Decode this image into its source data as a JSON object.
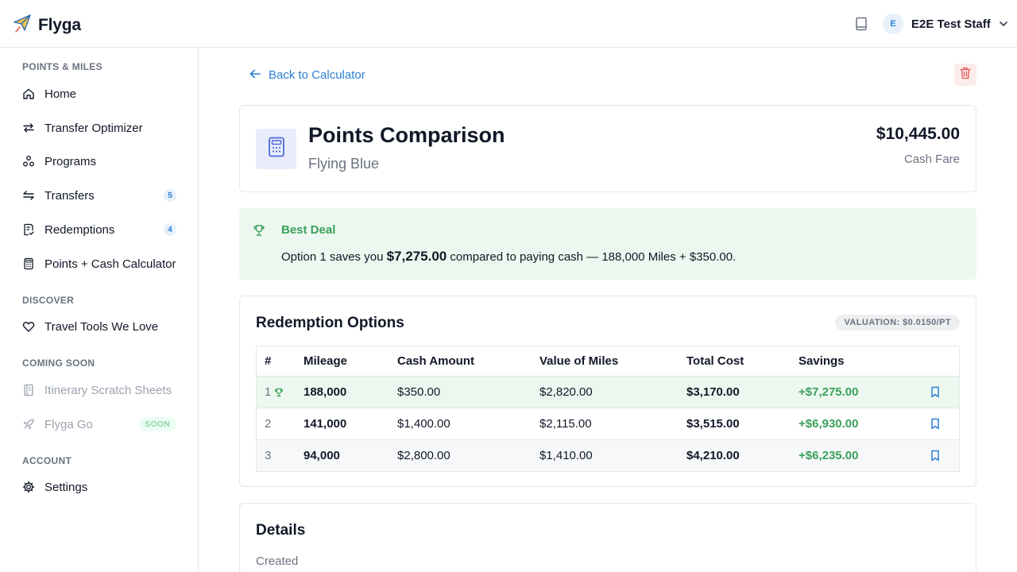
{
  "header": {
    "brand": "Flyga",
    "user_initial": "E",
    "user_name": "E2E Test Staff"
  },
  "sidebar": {
    "sections": [
      {
        "title": "POINTS & MILES"
      },
      {
        "title": "DISCOVER"
      },
      {
        "title": "COMING SOON"
      },
      {
        "title": "ACCOUNT"
      }
    ],
    "items": [
      {
        "label": "Home",
        "icon": "home-icon"
      },
      {
        "label": "Transfer Optimizer",
        "icon": "swap-icon"
      },
      {
        "label": "Programs",
        "icon": "programs-icon"
      },
      {
        "label": "Transfers",
        "icon": "transfers-icon",
        "badge": "5"
      },
      {
        "label": "Redemptions",
        "icon": "receipt-icon",
        "badge": "4"
      },
      {
        "label": "Points + Cash Calculator",
        "icon": "calculator-icon"
      },
      {
        "label": "Travel Tools We Love",
        "icon": "heart-icon"
      },
      {
        "label": "Itinerary Scratch Sheets",
        "icon": "notebook-icon"
      },
      {
        "label": "Flyga Go",
        "icon": "rocket-icon",
        "badge": "SOON"
      },
      {
        "label": "Settings",
        "icon": "gear-icon"
      }
    ]
  },
  "main": {
    "back_label": "Back to Calculator",
    "summary": {
      "title": "Points Comparison",
      "program": "Flying Blue",
      "cash_fare": "$10,445.00",
      "cash_fare_label": "Cash Fare"
    },
    "best_deal": {
      "title": "Best Deal",
      "text_before": "Option 1 saves you",
      "amount": "$7,275.00",
      "text_after": "compared to paying cash — 188,000 Miles + $350.00."
    },
    "options": {
      "title": "Redemption Options",
      "valuation": "VALUATION: $0.0150/PT",
      "columns": [
        "#",
        "Mileage",
        "Cash Amount",
        "Value of Miles",
        "Total Cost",
        "Savings"
      ],
      "rows": [
        {
          "rank": "1",
          "mileage": "188,000",
          "cash": "$350.00",
          "value": "$2,820.00",
          "total": "$3,170.00",
          "savings": "+$7,275.00"
        },
        {
          "rank": "2",
          "mileage": "141,000",
          "cash": "$1,400.00",
          "value": "$2,115.00",
          "total": "$3,515.00",
          "savings": "+$6,930.00"
        },
        {
          "rank": "3",
          "mileage": "94,000",
          "cash": "$2,800.00",
          "value": "$1,410.00",
          "total": "$4,210.00",
          "savings": "+$6,235.00"
        }
      ]
    },
    "details": {
      "title": "Details",
      "created_label": "Created"
    }
  },
  "colors": {
    "accent": "#2b7fd3",
    "success": "#3aa05a",
    "danger": "#e05555"
  }
}
